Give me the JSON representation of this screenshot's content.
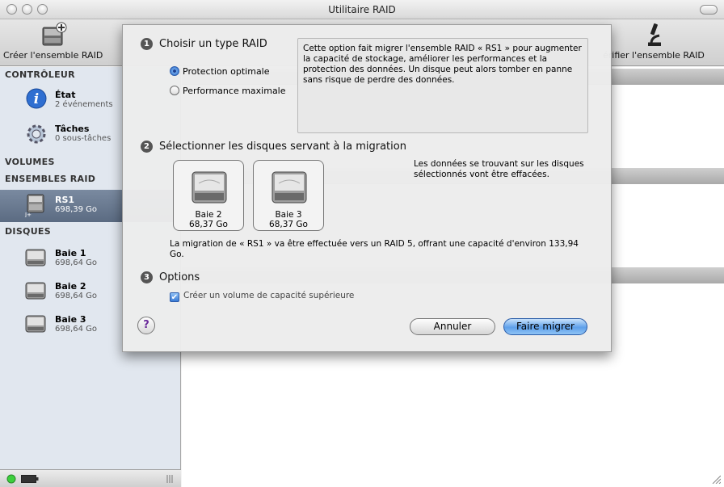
{
  "window": {
    "title": "Utilitaire RAID"
  },
  "toolbar": {
    "create_label": "Créer l'ensemble RAID",
    "verify_label": "érifier l'ensemble RAID"
  },
  "sidebar": {
    "controller_header": "CONTRÔLEUR",
    "status": {
      "name": "État",
      "sub": "2 événements"
    },
    "tasks": {
      "name": "Tâches",
      "sub": "0 sous-tâches"
    },
    "volumes_header": "VOLUMES",
    "raid_header": "ENSEMBLES RAID",
    "raid_set": {
      "name": "RS1",
      "sub": "698,39 Go"
    },
    "disks_header": "DISQUES",
    "disks": [
      {
        "name": "Baie 1",
        "sub": "698,64 Go"
      },
      {
        "name": "Baie 2",
        "sub": "698,64 Go"
      },
      {
        "name": "Baie 3",
        "sub": "698,64 Go"
      }
    ]
  },
  "sheet": {
    "step1": {
      "num": "1",
      "title": "Choisir un type RAID"
    },
    "radio_optimal": "Protection optimale",
    "radio_max": "Performance maximale",
    "info_text": "Cette option fait migrer l'ensemble RAID « RS1 » pour augmenter la capacité de stockage, améliorer les performances et la protection des données. Un disque peut alors tomber en panne sans risque de perdre des données.",
    "step2": {
      "num": "2",
      "title": "Sélectionner les disques servant à la migration"
    },
    "disk_warning": "Les données se trouvant sur les disques sélectionnés vont être effacées.",
    "disk_a": {
      "name": "Baie 2",
      "size": "68,37 Go"
    },
    "disk_b": {
      "name": "Baie 3",
      "size": "68,37 Go"
    },
    "migration_note": "La migration de « RS1 » va être effectuée vers un RAID 5, offrant une capacité d'environ 133,94 Go.",
    "step3": {
      "num": "3",
      "title": "Options"
    },
    "option_label": "Créer un volume de capacité supérieure",
    "help_label": "?",
    "cancel_label": "Annuler",
    "migrate_label": "Faire migrer"
  }
}
